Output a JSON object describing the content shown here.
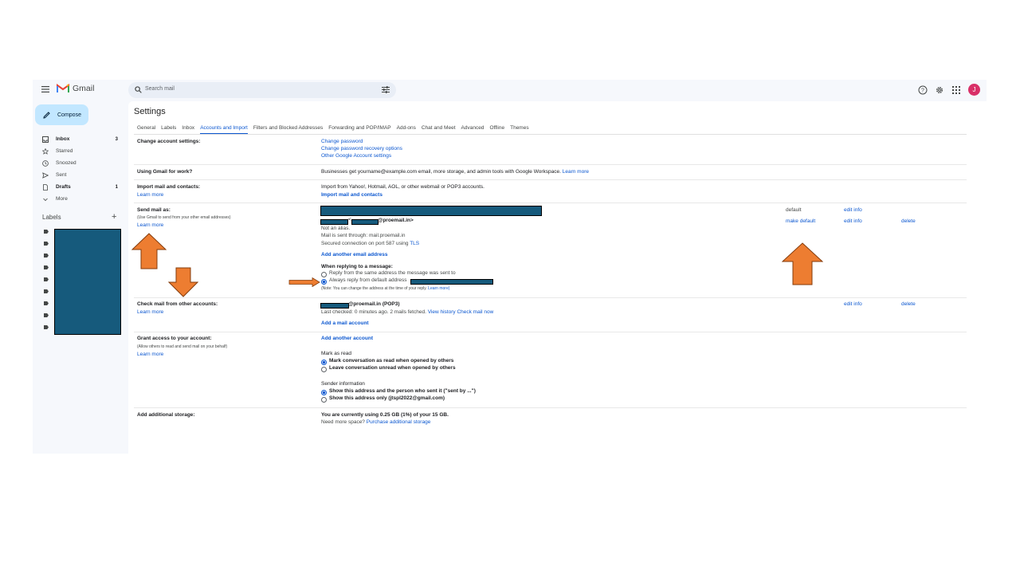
{
  "app": {
    "brand": "Gmail",
    "avatar_letter": "J"
  },
  "search": {
    "placeholder": "Search mail"
  },
  "compose_label": "Compose",
  "nav": [
    {
      "label": "Inbox",
      "count": "3",
      "icon": "inbox-icon",
      "bold": true
    },
    {
      "label": "Starred",
      "count": "",
      "icon": "star-icon",
      "bold": false
    },
    {
      "label": "Snoozed",
      "count": "",
      "icon": "clock-icon",
      "bold": false
    },
    {
      "label": "Sent",
      "count": "",
      "icon": "send-icon",
      "bold": false
    },
    {
      "label": "Drafts",
      "count": "1",
      "icon": "draft-icon",
      "bold": true
    },
    {
      "label": "More",
      "count": "",
      "icon": "chevron-down-icon",
      "bold": false
    }
  ],
  "labels_header": "Labels",
  "labels_add": "+",
  "settings_title": "Settings",
  "tabs": [
    "General",
    "Labels",
    "Inbox",
    "Accounts and Import",
    "Filters and Blocked Addresses",
    "Forwarding and POP/IMAP",
    "Add-ons",
    "Chat and Meet",
    "Advanced",
    "Offline",
    "Themes"
  ],
  "active_tab": "Accounts and Import",
  "rows": {
    "change": {
      "label": "Change account settings:",
      "links": [
        "Change password",
        "Change password recovery options",
        "Other Google Account settings"
      ]
    },
    "work": {
      "label": "Using Gmail for work?",
      "text": "Businesses get yourname@example.com email, more storage, and admin tools with Google Workspace.",
      "link": "Learn more"
    },
    "import": {
      "label": "Import mail and contacts:",
      "learn": "Learn more",
      "text": "Import from Yahoo!, Hotmail, AOL, or other webmail or POP3 accounts.",
      "action": "Import mail and contacts"
    },
    "send": {
      "label": "Send mail as:",
      "sub": "(Use Gmail to send from your other email addresses)",
      "learn": "Learn more",
      "addr2": "@proemail.in>",
      "lt": "<",
      "not_alias": "Not an alias.",
      "sent_through": "Mail is sent through: mail.proemail.in",
      "secured": "Secured connection on port 587 using",
      "tls": "TLS",
      "add_another": "Add another email address",
      "reply_hdr": "When replying to a message:",
      "reply_opt1": "Reply from the same address the message was sent to",
      "reply_opt2": "Always reply from default address",
      "note": "(Note: You can change the address at the time of your reply.",
      "note_link": "Learn more)",
      "default": "default",
      "edit_info_1": "edit info",
      "make_default": "make default",
      "edit_info_2": "edit info",
      "delete": "delete"
    },
    "check": {
      "label": "Check mail from other accounts:",
      "learn": "Learn more",
      "addr": "@proemail.in (POP3)",
      "last_checked": "Last checked: 0 minutes ago. 2 mails fetched.",
      "view_history": "View history",
      "check_now": "Check mail now",
      "add": "Add a mail account",
      "edit_info": "edit info",
      "delete": "delete"
    },
    "grant": {
      "label": "Grant access to your account:",
      "sub": "(Allow others to read and send mail on your behalf)",
      "learn": "Learn more",
      "add": "Add another account",
      "mark_hdr": "Mark as read",
      "mark_opt1": "Mark conversation as read when opened by others",
      "mark_opt2": "Leave conversation unread when opened by others",
      "sender_hdr": "Sender information",
      "sender_opt1": "Show this address and the person who sent it (\"sent by ...\")",
      "sender_opt2": "Show this address only (jtspl2022@gmail.com)"
    },
    "storage": {
      "label": "Add additional storage:",
      "usage": "You are currently using 0.25 GB (1%) of your 15 GB.",
      "need": "Need more space?",
      "purchase": "Purchase additional storage"
    }
  },
  "colors": {
    "accent": "#0b57d0",
    "arrow": "#ed7d31",
    "redaction": "#165a7c",
    "compose": "#c2e7ff",
    "avatar": "#d93068"
  }
}
